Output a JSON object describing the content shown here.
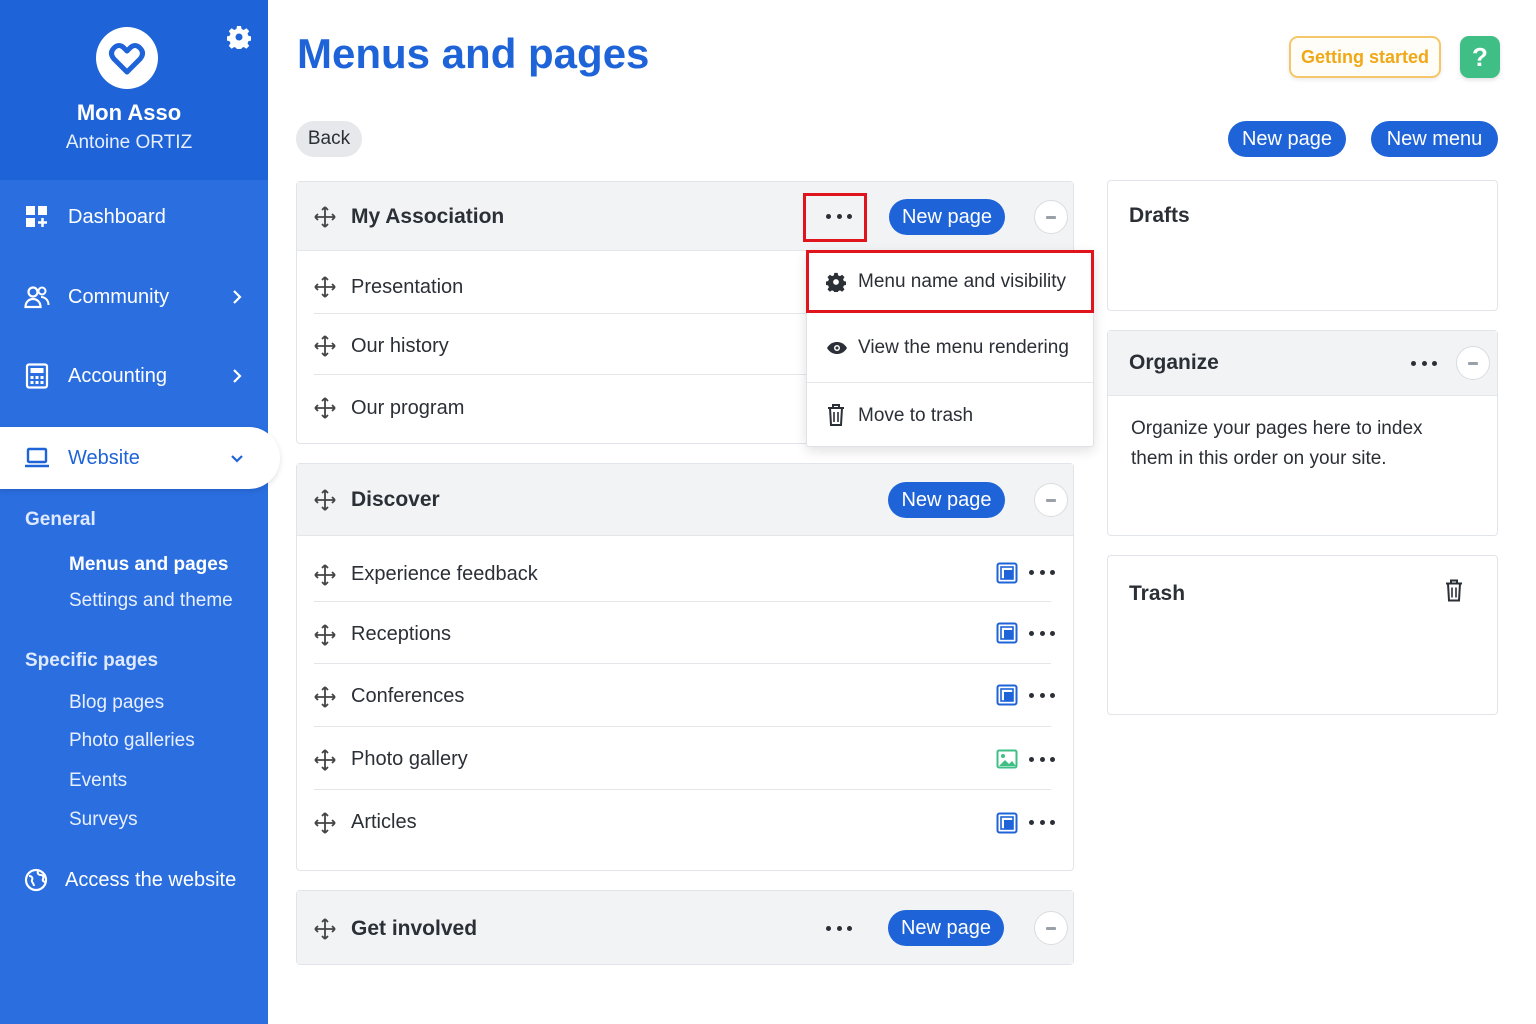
{
  "sidebar": {
    "org_name": "Mon Asso",
    "user_name": "Antoine ORTIZ",
    "nav": {
      "dashboard": "Dashboard",
      "community": "Community",
      "accounting": "Accounting",
      "website": "Website"
    },
    "section_general": "General",
    "general_items": [
      "Menus and pages",
      "Settings and theme"
    ],
    "section_specific": "Specific pages",
    "specific_items": [
      "Blog pages",
      "Photo galleries",
      "Events",
      "Surveys"
    ],
    "access_website": "Access the website"
  },
  "header": {
    "title": "Menus and pages",
    "getting_started": "Getting started",
    "help": "?",
    "back": "Back",
    "new_page": "New page",
    "new_menu": "New menu"
  },
  "menus": [
    {
      "title": "My Association",
      "new_page": "New page",
      "pages": [
        "Presentation",
        "Our history",
        "Our program"
      ]
    },
    {
      "title": "Discover",
      "new_page": "New page",
      "pages": [
        {
          "title": "Experience feedback",
          "icon": "page-icon"
        },
        {
          "title": "Receptions",
          "icon": "page-icon"
        },
        {
          "title": "Conferences",
          "icon": "page-icon"
        },
        {
          "title": "Photo gallery",
          "icon": "gallery-icon"
        },
        {
          "title": "Articles",
          "icon": "page-icon"
        }
      ]
    },
    {
      "title": "Get involved",
      "new_page": "New page"
    }
  ],
  "dropdown": {
    "items": [
      "Menu name and visibility",
      "View the menu rendering",
      "Move to trash"
    ]
  },
  "panels": {
    "drafts": "Drafts",
    "organize_title": "Organize",
    "organize_text": "Organize your pages here to index them in this order on your site.",
    "trash": "Trash"
  },
  "colors": {
    "primary": "#1e63d8",
    "sidebar": "#2a6ee0",
    "highlight": "#e0141c",
    "getting_started": "#f0a818",
    "help": "#3fbf86"
  }
}
